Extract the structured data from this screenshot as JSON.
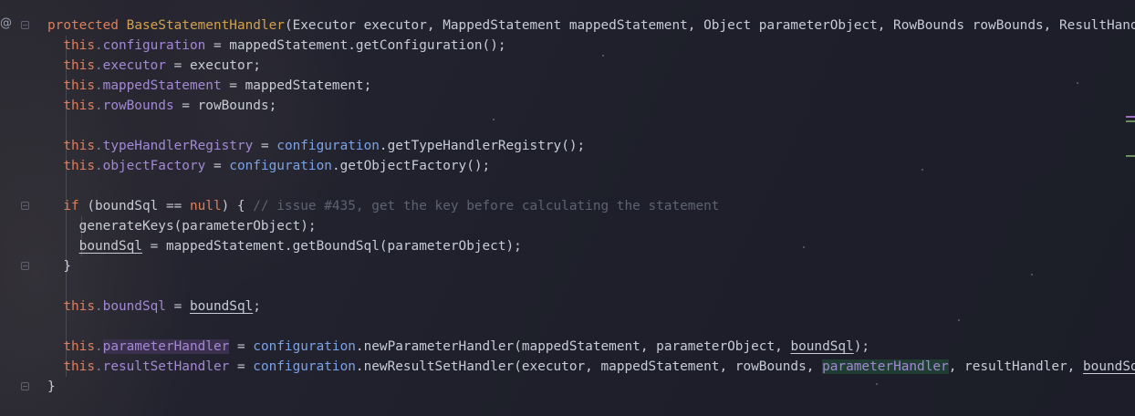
{
  "gutter": {
    "annotation_icon": "@",
    "fold_icons": [
      "fold-minus-icon"
    ]
  },
  "code": {
    "constructor_signature": {
      "modifier": "protected",
      "class_name": "BaseStatementHandler",
      "params": "(Executor executor, MappedStatement mappedStatement, Object parameterObject, RowBounds rowBounds, ResultHandler resultHandler, BoundSql boundSql) {"
    },
    "lines": [
      {
        "this": "this",
        "dot": ".",
        "field": "configuration",
        "rest": " = mappedStatement.getConfiguration();"
      },
      {
        "this": "this",
        "dot": ".",
        "field": "executor",
        "rest": " = executor;"
      },
      {
        "this": "this",
        "dot": ".",
        "field": "mappedStatement",
        "rest": " = mappedStatement;"
      },
      {
        "this": "this",
        "dot": ".",
        "field": "rowBounds",
        "rest": " = rowBounds;"
      },
      {
        "this": "this",
        "dot": ".",
        "field": "typeHandlerRegistry",
        "mid": " = ",
        "cfg": "configuration",
        "rest": ".getTypeHandlerRegistry();"
      },
      {
        "this": "this",
        "dot": ".",
        "field": "objectFactory",
        "mid": " = ",
        "cfg": "configuration",
        "rest": ".getObjectFactory();"
      }
    ],
    "if_block": {
      "if_kw": "if",
      "cond_a": " (boundSql == ",
      "null_kw": "null",
      "cond_b": ") { ",
      "comment": "// issue #435, get the key before calculating the statement",
      "line1": "generateKeys(parameterObject);",
      "line2_var": "boundSql",
      "line2_rest": " = mappedStatement.getBoundSql(parameterObject);",
      "close": "}"
    },
    "bound_line": {
      "this": "this",
      "dot": ".",
      "field": "boundSql",
      "mid": " = ",
      "var": "boundSql",
      "end": ";"
    },
    "param_line": {
      "this": "this",
      "dot": ".",
      "field": "parameterHandler",
      "mid": " = ",
      "cfg": "configuration",
      "call": ".newParameterHandler(mappedStatement, parameterObject, ",
      "var": "boundSql",
      "end": ");"
    },
    "result_line": {
      "this": "this",
      "dot": ".",
      "field": "resultSetHandler",
      "mid": " = ",
      "cfg": "configuration",
      "call": ".newResultSetHandler(executor, mappedStatement, rowBounds, ",
      "hl": "parameterHandler",
      "rest": ", resultHandler, ",
      "tail": "boundSql);"
    },
    "closing_brace": "}"
  }
}
